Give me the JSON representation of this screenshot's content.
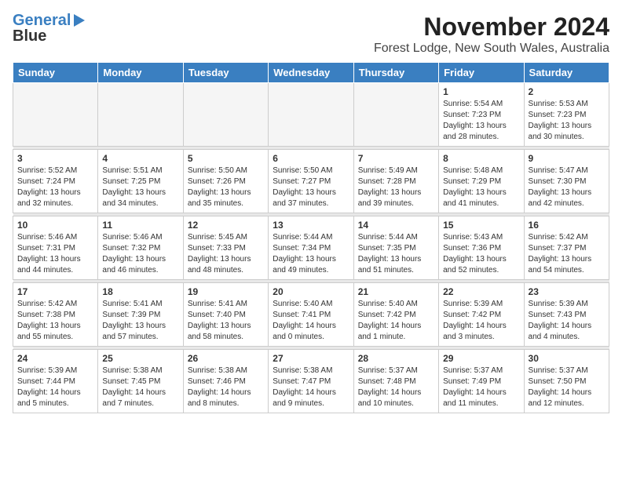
{
  "header": {
    "logo_general": "General",
    "logo_blue": "Blue",
    "title": "November 2024",
    "subtitle": "Forest Lodge, New South Wales, Australia"
  },
  "days_of_week": [
    "Sunday",
    "Monday",
    "Tuesday",
    "Wednesday",
    "Thursday",
    "Friday",
    "Saturday"
  ],
  "weeks": [
    [
      {
        "day": "",
        "empty": true
      },
      {
        "day": "",
        "empty": true
      },
      {
        "day": "",
        "empty": true
      },
      {
        "day": "",
        "empty": true
      },
      {
        "day": "",
        "empty": true
      },
      {
        "day": "1",
        "sunrise": "5:54 AM",
        "sunset": "7:23 PM",
        "daylight": "13 hours and 28 minutes."
      },
      {
        "day": "2",
        "sunrise": "5:53 AM",
        "sunset": "7:23 PM",
        "daylight": "13 hours and 30 minutes."
      }
    ],
    [
      {
        "day": "3",
        "sunrise": "5:52 AM",
        "sunset": "7:24 PM",
        "daylight": "13 hours and 32 minutes."
      },
      {
        "day": "4",
        "sunrise": "5:51 AM",
        "sunset": "7:25 PM",
        "daylight": "13 hours and 34 minutes."
      },
      {
        "day": "5",
        "sunrise": "5:50 AM",
        "sunset": "7:26 PM",
        "daylight": "13 hours and 35 minutes."
      },
      {
        "day": "6",
        "sunrise": "5:50 AM",
        "sunset": "7:27 PM",
        "daylight": "13 hours and 37 minutes."
      },
      {
        "day": "7",
        "sunrise": "5:49 AM",
        "sunset": "7:28 PM",
        "daylight": "13 hours and 39 minutes."
      },
      {
        "day": "8",
        "sunrise": "5:48 AM",
        "sunset": "7:29 PM",
        "daylight": "13 hours and 41 minutes."
      },
      {
        "day": "9",
        "sunrise": "5:47 AM",
        "sunset": "7:30 PM",
        "daylight": "13 hours and 42 minutes."
      }
    ],
    [
      {
        "day": "10",
        "sunrise": "5:46 AM",
        "sunset": "7:31 PM",
        "daylight": "13 hours and 44 minutes."
      },
      {
        "day": "11",
        "sunrise": "5:46 AM",
        "sunset": "7:32 PM",
        "daylight": "13 hours and 46 minutes."
      },
      {
        "day": "12",
        "sunrise": "5:45 AM",
        "sunset": "7:33 PM",
        "daylight": "13 hours and 48 minutes."
      },
      {
        "day": "13",
        "sunrise": "5:44 AM",
        "sunset": "7:34 PM",
        "daylight": "13 hours and 49 minutes."
      },
      {
        "day": "14",
        "sunrise": "5:44 AM",
        "sunset": "7:35 PM",
        "daylight": "13 hours and 51 minutes."
      },
      {
        "day": "15",
        "sunrise": "5:43 AM",
        "sunset": "7:36 PM",
        "daylight": "13 hours and 52 minutes."
      },
      {
        "day": "16",
        "sunrise": "5:42 AM",
        "sunset": "7:37 PM",
        "daylight": "13 hours and 54 minutes."
      }
    ],
    [
      {
        "day": "17",
        "sunrise": "5:42 AM",
        "sunset": "7:38 PM",
        "daylight": "13 hours and 55 minutes."
      },
      {
        "day": "18",
        "sunrise": "5:41 AM",
        "sunset": "7:39 PM",
        "daylight": "13 hours and 57 minutes."
      },
      {
        "day": "19",
        "sunrise": "5:41 AM",
        "sunset": "7:40 PM",
        "daylight": "13 hours and 58 minutes."
      },
      {
        "day": "20",
        "sunrise": "5:40 AM",
        "sunset": "7:41 PM",
        "daylight": "14 hours and 0 minutes."
      },
      {
        "day": "21",
        "sunrise": "5:40 AM",
        "sunset": "7:42 PM",
        "daylight": "14 hours and 1 minute."
      },
      {
        "day": "22",
        "sunrise": "5:39 AM",
        "sunset": "7:42 PM",
        "daylight": "14 hours and 3 minutes."
      },
      {
        "day": "23",
        "sunrise": "5:39 AM",
        "sunset": "7:43 PM",
        "daylight": "14 hours and 4 minutes."
      }
    ],
    [
      {
        "day": "24",
        "sunrise": "5:39 AM",
        "sunset": "7:44 PM",
        "daylight": "14 hours and 5 minutes."
      },
      {
        "day": "25",
        "sunrise": "5:38 AM",
        "sunset": "7:45 PM",
        "daylight": "14 hours and 7 minutes."
      },
      {
        "day": "26",
        "sunrise": "5:38 AM",
        "sunset": "7:46 PM",
        "daylight": "14 hours and 8 minutes."
      },
      {
        "day": "27",
        "sunrise": "5:38 AM",
        "sunset": "7:47 PM",
        "daylight": "14 hours and 9 minutes."
      },
      {
        "day": "28",
        "sunrise": "5:37 AM",
        "sunset": "7:48 PM",
        "daylight": "14 hours and 10 minutes."
      },
      {
        "day": "29",
        "sunrise": "5:37 AM",
        "sunset": "7:49 PM",
        "daylight": "14 hours and 11 minutes."
      },
      {
        "day": "30",
        "sunrise": "5:37 AM",
        "sunset": "7:50 PM",
        "daylight": "14 hours and 12 minutes."
      }
    ]
  ],
  "labels": {
    "sunrise": "Sunrise:",
    "sunset": "Sunset:",
    "daylight": "Daylight:"
  }
}
